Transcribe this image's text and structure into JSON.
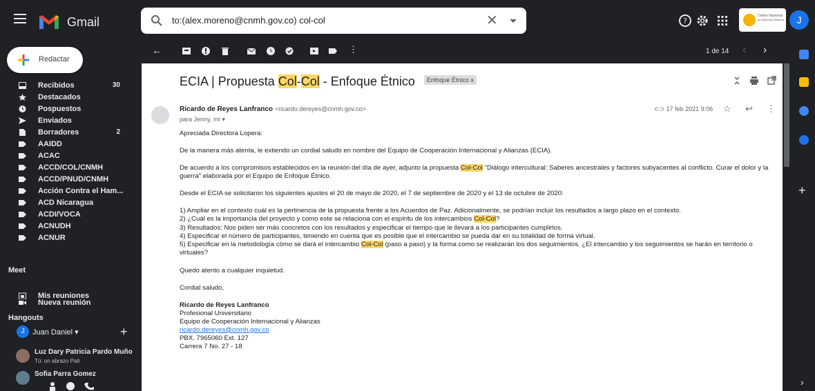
{
  "app": {
    "brand": "Gmail"
  },
  "search": {
    "query": "to:(alex.moreno@cnmh.gov.co) col-col"
  },
  "org": {
    "name_line1": "Centro Nacional",
    "name_line2": "de Memoria Histórica"
  },
  "account": {
    "initial": "J"
  },
  "compose": {
    "label": "Redactar"
  },
  "nav": [
    {
      "label": "Recibidos",
      "count": "30",
      "icon": "inbox-icon"
    },
    {
      "label": "Destacados",
      "count": "",
      "icon": "star-icon"
    },
    {
      "label": "Pospuestos",
      "count": "",
      "icon": "clock-icon"
    },
    {
      "label": "Enviados",
      "count": "",
      "icon": "send-icon"
    },
    {
      "label": "Borradores",
      "count": "2",
      "icon": "draft-icon"
    },
    {
      "label": "AAIDD",
      "count": "",
      "icon": "label-icon"
    },
    {
      "label": "ACAC",
      "count": "",
      "icon": "label-icon"
    },
    {
      "label": "ACCD/COL/CNMH",
      "count": "",
      "icon": "label-icon"
    },
    {
      "label": "ACCD/PNUD/CNMH",
      "count": "",
      "icon": "label-icon"
    },
    {
      "label": "Acción Contra el Ham...",
      "count": "",
      "icon": "label-icon"
    },
    {
      "label": "ACD Nicaragua",
      "count": "",
      "icon": "label-icon"
    },
    {
      "label": "ACDI/VOCA",
      "count": "",
      "icon": "label-icon"
    },
    {
      "label": "ACNUDH",
      "count": "",
      "icon": "label-icon"
    },
    {
      "label": "ACNUR",
      "count": "",
      "icon": "label-icon"
    }
  ],
  "meet": {
    "title": "Meet",
    "new_meeting": "Nueva reunión",
    "my_meetings": "Mis reuniones"
  },
  "hangouts": {
    "title": "Hangouts",
    "user": "Juan Daniel",
    "user_initial": "J",
    "contacts": [
      {
        "name": "Luz Dary Patricia Pardo Muño",
        "status": "Tú: un abrazo Pati"
      },
      {
        "name": "Sofia Parra Gomez",
        "status": ""
      }
    ]
  },
  "toolbar": {
    "pager": "1 de 14"
  },
  "message": {
    "subject_prefix": "ECIA | Propuesta ",
    "subject_hl1": "Col",
    "subject_dash": "-",
    "subject_hl2": "Col",
    "subject_suffix": " - Enfoque Étnico",
    "tag": "Enfoque Étnico",
    "sender_name": "Ricardo de Reyes Lanfranco",
    "sender_email": "<ricardo.dereyes@cnmh.gov.co>",
    "to": "para Jenny, mí",
    "date": "17 feb 2021 9:06",
    "greeting": "Apreciada Directora Lopera:",
    "p1": "De la manera más atenta, le extiendo un cordial saludo en nombre del Equipo de Cooperación Internacional y Alianzas (ECIA).",
    "p2_a": "De acuerdo a los compromisos establecidos en la reunión del día de ayer, adjunto la propuesta ",
    "p2_hl": "Col-Col",
    "p2_b": " \"Diálogo intercultural: Saberes ancestrales y factores subyacentes al conflicto. Curar el dolor y la guerra\" elaborada por el Equipo de Enfoque Étnico.",
    "p3": "Desde el ECIA se solicitaron los siguientes ajustes el 20 de mayo de 2020, el 7 de septiembre de 2020 y el 13 de octubre de 2020:",
    "item1": "1) Ampliar en el contexto cuál es la pertinencia de la propuesta frente a los Acuerdos de Paz. Adicionalmente, se podrían incluir los resultados a largo plazo en el contexto.",
    "item2_a": "2) ¿Cuál es la importancia del proyecto y como este se relaciona con el espíritu de los intercambios ",
    "item2_hl": "Col-Col",
    "item2_b": "?",
    "item3": "3) Resultados: Nos piden ser más concretos con los resultados y especificar el tiempo que le llevará a los participantes cumplirlos.",
    "item4": "4) Especificar el número de participantes, teniendo en cuenta que es posible que el intercambio se pueda dar en su totalidad de forma virtual.",
    "item5_a": "5) Especificar en la metodología cómo se dará el intercambio ",
    "item5_hl": "Col-Col",
    "item5_b": " (paso a paso) y la forma como se realizarán los dos seguimientos. ¿El intercambio y los seguimientos se harán en territorio o virtuales?",
    "p4": "Quedo atento a cualquier inquietud.",
    "closing": "Cordial saludo,",
    "sig_name": "Ricardo de Reyes Lanfranco",
    "sig_role": "Profesional Universitario",
    "sig_team": "Equipo de Cooperación Internacional y Alianzas",
    "sig_email": "ricardo.dereyes@cnmh.gov.co",
    "sig_phone": "PBX. 7965060 Ext. 127",
    "sig_address": "Carrera 7 No. 27 - 18"
  }
}
